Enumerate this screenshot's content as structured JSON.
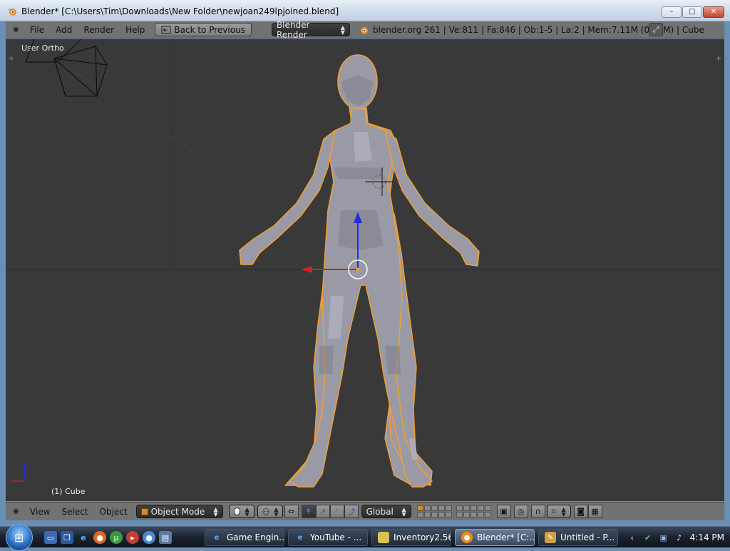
{
  "window": {
    "title": "Blender* [C:\\Users\\Tim\\Downloads\\New Folder\\newjoan249lpjoined.blend]",
    "controls": {
      "minimize": "–",
      "maximize": "□",
      "close": "✕"
    }
  },
  "info_header": {
    "menus": [
      "File",
      "Add",
      "Render",
      "Help"
    ],
    "back_button": "Back to Previous",
    "render_engine": "Blender Render",
    "stats": "blender.org 261 | Ve:811 | Fa:846 | Ob:1-5 | La:2 | Mem:7.11M (0.10M) | Cube"
  },
  "viewport": {
    "view_label": "User Ortho",
    "object_label": "(1) Cube"
  },
  "view_header": {
    "menus": [
      "View",
      "Select",
      "Object"
    ],
    "mode": "Object Mode",
    "orientation": "Global"
  },
  "taskbar": {
    "tasks": [
      {
        "label": "Game Engin...",
        "icon": "ie-icon",
        "active": false
      },
      {
        "label": "YouTube - ...",
        "icon": "ie-icon",
        "active": false
      },
      {
        "label": "Inventory2.56",
        "icon": "folder-icon",
        "active": false
      },
      {
        "label": "Blender* [C:...",
        "icon": "blender-icon",
        "active": true
      },
      {
        "label": "Untitled - P...",
        "icon": "paint-icon",
        "active": false
      }
    ],
    "clock": "4:14 PM"
  },
  "colors": {
    "viewport_bg": "#393939",
    "header_bg": "#727272",
    "selection_outline": "#f0a030",
    "axis_x": "#d22020",
    "axis_z": "#2030e0"
  }
}
